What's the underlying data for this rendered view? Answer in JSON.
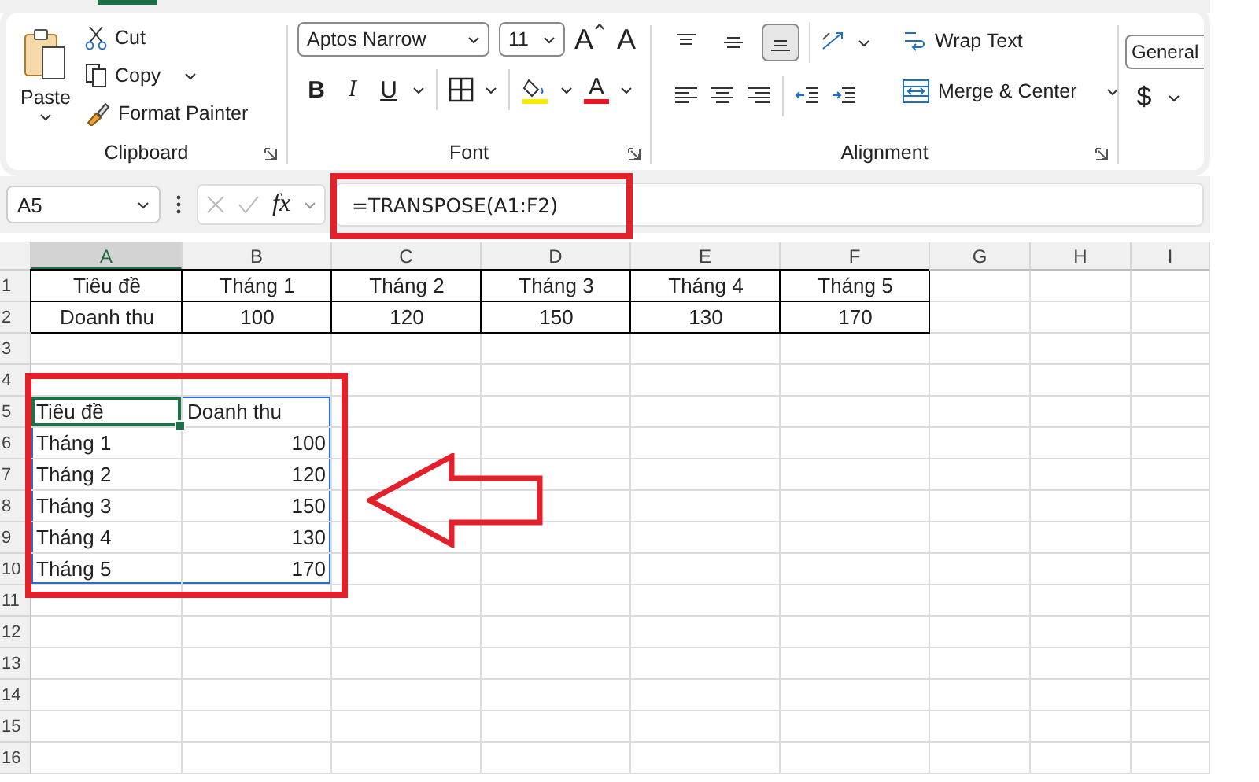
{
  "ribbon": {
    "clipboard": {
      "label": "Clipboard",
      "paste": "Paste",
      "actions": [
        {
          "label": "Cut",
          "kind": "cut"
        },
        {
          "label": "Copy",
          "kind": "copy"
        },
        {
          "label": "Format Painter",
          "kind": "painter"
        }
      ]
    },
    "font": {
      "label": "Font",
      "font_name": "Aptos Narrow",
      "font_size": "11",
      "grow": "A",
      "shrink": "A",
      "bold": "B",
      "italic": "I",
      "underline": "U",
      "font_color": "A"
    },
    "alignment": {
      "label": "Alignment",
      "vertical": [
        {
          "kind": "top",
          "selected": false
        },
        {
          "kind": "middle",
          "selected": false
        },
        {
          "kind": "bottom",
          "selected": true
        }
      ],
      "wrap_text": "Wrap Text",
      "merge": "Merge & Center"
    },
    "number": {
      "format": "General",
      "currency": "$"
    }
  },
  "formula_bar": {
    "name_box": "A5",
    "fx": "fx",
    "formula": "=TRANSPOSE(A1:F2)"
  },
  "sheet": {
    "columns": [
      {
        "label": "A",
        "selected": true
      },
      {
        "label": "B",
        "selected": false
      },
      {
        "label": "C",
        "selected": false
      },
      {
        "label": "D",
        "selected": false
      },
      {
        "label": "E",
        "selected": false
      },
      {
        "label": "F",
        "selected": false
      },
      {
        "label": "G",
        "selected": false
      },
      {
        "label": "H",
        "selected": false
      },
      {
        "label": "I",
        "selected": false
      }
    ],
    "rows": [
      {
        "number": "1",
        "kind": "source",
        "cells": [
          {
            "text": "Tiêu đề",
            "active": false
          },
          {
            "text": "Tháng 1",
            "active": false
          },
          {
            "text": "Tháng 2",
            "active": false
          },
          {
            "text": "Tháng 3",
            "active": false
          },
          {
            "text": "Tháng 4",
            "active": false
          },
          {
            "text": "Tháng 5",
            "active": false
          }
        ]
      },
      {
        "number": "2",
        "kind": "source",
        "cells": [
          {
            "text": "Doanh thu",
            "active": false
          },
          {
            "text": "100",
            "active": false
          },
          {
            "text": "120",
            "active": false
          },
          {
            "text": "150",
            "active": false
          },
          {
            "text": "130",
            "active": false
          },
          {
            "text": "170",
            "active": false
          }
        ]
      },
      {
        "number": "3",
        "kind": "empty",
        "cells": []
      },
      {
        "number": "4",
        "kind": "empty",
        "cells": []
      },
      {
        "number": "5",
        "kind": "spill_header",
        "cells": [
          {
            "text": "Tiêu đề",
            "active": true
          },
          {
            "text": "Doanh thu",
            "active": false
          }
        ]
      },
      {
        "number": "6",
        "kind": "spill",
        "cells": [
          {
            "text": "Tháng 1",
            "active": false
          },
          {
            "text": "100",
            "active": false
          }
        ]
      },
      {
        "number": "7",
        "kind": "spill",
        "cells": [
          {
            "text": "Tháng 2",
            "active": false
          },
          {
            "text": "120",
            "active": false
          }
        ]
      },
      {
        "number": "8",
        "kind": "spill",
        "cells": [
          {
            "text": "Tháng 3",
            "active": false
          },
          {
            "text": "150",
            "active": false
          }
        ]
      },
      {
        "number": "9",
        "kind": "spill",
        "cells": [
          {
            "text": "Tháng 4",
            "active": false
          },
          {
            "text": "130",
            "active": false
          }
        ]
      },
      {
        "number": "10",
        "kind": "spill",
        "cells": [
          {
            "text": "Tháng 5",
            "active": false
          },
          {
            "text": "170",
            "active": false
          }
        ]
      },
      {
        "number": "11",
        "kind": "empty",
        "cells": []
      },
      {
        "number": "12",
        "kind": "empty",
        "cells": []
      },
      {
        "number": "13",
        "kind": "empty",
        "cells": []
      },
      {
        "number": "14",
        "kind": "empty",
        "cells": []
      },
      {
        "number": "15",
        "kind": "empty",
        "cells": []
      },
      {
        "number": "16",
        "kind": "empty",
        "cells": []
      }
    ]
  }
}
